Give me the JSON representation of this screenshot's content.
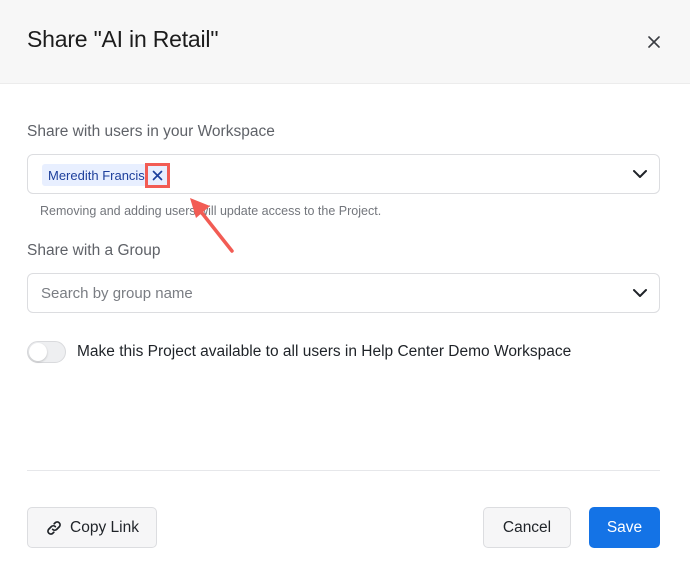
{
  "dialog": {
    "title": "Share \"AI in Retail\""
  },
  "users_section": {
    "label": "Share with users in your Workspace",
    "selected_user": "Meredith Francis",
    "helper_text": "Removing and adding users will update access to the Project."
  },
  "group_section": {
    "label": "Share with a Group",
    "placeholder": "Search by group name"
  },
  "workspace_toggle": {
    "label": "Make this Project available to all users in Help Center Demo Workspace",
    "enabled": false
  },
  "footer": {
    "copy_link_label": "Copy Link",
    "cancel_label": "Cancel",
    "save_label": "Save"
  },
  "colors": {
    "primary": "#1473e6",
    "chip_bg": "#e8efff",
    "chip_text": "#1d3f9c",
    "annotation": "#f25c54"
  },
  "icons": {
    "close": "close-icon",
    "chevron": "chevron-down-icon",
    "remove": "remove-chip-icon",
    "link": "link-icon",
    "annotation_arrow": "annotation-arrow-icon"
  }
}
